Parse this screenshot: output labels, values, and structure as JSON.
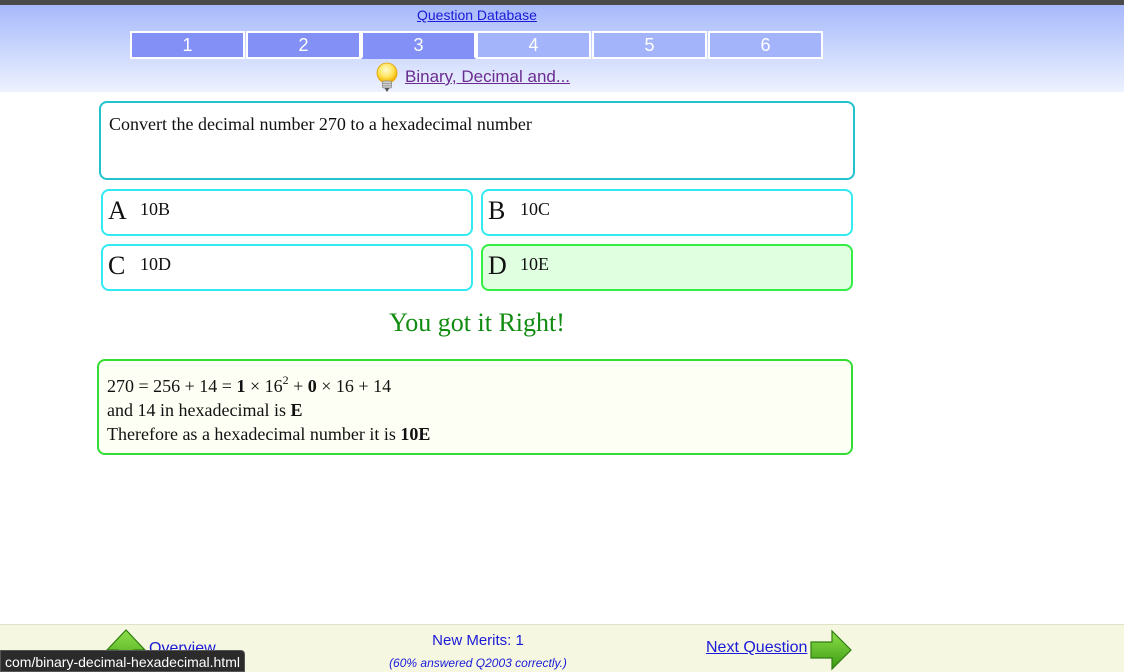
{
  "header": {
    "database_link": "Question Database",
    "tabs": [
      {
        "label": "1",
        "state": "done"
      },
      {
        "label": "2",
        "state": "done"
      },
      {
        "label": "3",
        "state": "current"
      },
      {
        "label": "4",
        "state": "todo"
      },
      {
        "label": "5",
        "state": "todo"
      },
      {
        "label": "6",
        "state": "todo"
      }
    ],
    "topic_icon": "lightbulb-icon",
    "topic_link": "Binary, Decimal and..."
  },
  "question": {
    "text": "Convert the decimal number 270 to a hexadecimal number"
  },
  "answers": [
    {
      "letter": "A",
      "text": "10B",
      "correct": false
    },
    {
      "letter": "B",
      "text": "10C",
      "correct": false
    },
    {
      "letter": "C",
      "text": "10D",
      "correct": false
    },
    {
      "letter": "D",
      "text": "10E",
      "correct": true
    }
  ],
  "result": {
    "message": "You got it Right!",
    "color": "#118c11"
  },
  "explanation": {
    "line1": {
      "p1": "270 = 256 + 14 = ",
      "b1": "1",
      "p2": " × 16",
      "sup": "2",
      "p3": " + ",
      "b2": "0",
      "p4": " × 16 + 14"
    },
    "line2": {
      "text": "and 14 in hexadecimal is ",
      "bold": "E"
    },
    "line3": {
      "text": "Therefore as a hexadecimal number it is ",
      "bold": "10E"
    }
  },
  "footer": {
    "overview_icon": "up-arrow-icon",
    "overview_link": "Overview",
    "merits": "New Merits: 1",
    "stats": "(60% answered Q2003 correctly.)",
    "next_link": "Next Question",
    "next_icon": "right-arrow-icon"
  },
  "status_bar": {
    "url": "com/binary-decimal-hexadecimal.html"
  },
  "colors": {
    "tab_active": "#8391f7",
    "tab_inactive": "#a3b4fb",
    "question_border": "#22c3cf",
    "answer_border": "#33eaf2",
    "correct_border": "#33ee44",
    "correct_fill": "#dfffe0",
    "link": "#1a1ad8"
  }
}
